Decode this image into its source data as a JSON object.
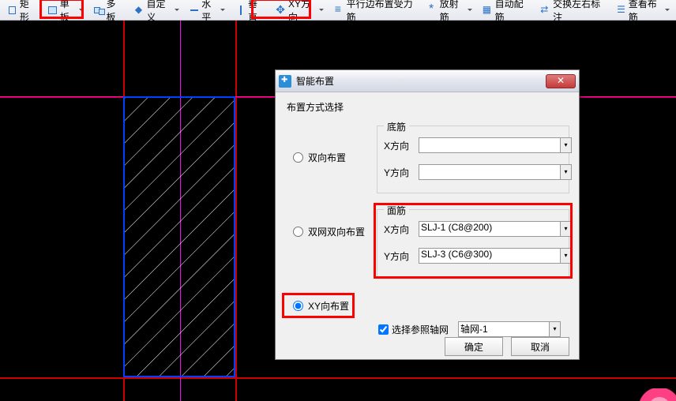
{
  "toolbar": {
    "items": [
      {
        "name": "rect-button",
        "icon": "ic-rect",
        "label": "矩形",
        "arrow": false
      },
      {
        "name": "single-board-button",
        "icon": "ic-board",
        "label": "单板",
        "arrow": true
      },
      {
        "name": "multi-board-button",
        "icon": "ic-multi",
        "label": "多板",
        "arrow": false
      },
      {
        "name": "custom-button",
        "icon": "ic-custom",
        "label": "自定义",
        "arrow": true
      },
      {
        "name": "horizontal-button",
        "icon": "ic-horiz",
        "label": "水平",
        "arrow": true
      },
      {
        "name": "vertical-button",
        "icon": "ic-vert",
        "label": "垂直",
        "arrow": false
      },
      {
        "name": "xy-direction-button",
        "icon": "ic-xy",
        "label": "XY方向",
        "arrow": true
      },
      {
        "name": "parallel-edge-button",
        "icon": "ic-parallel",
        "label": "平行边布置受力筋",
        "arrow": false
      },
      {
        "name": "radial-rebar-button",
        "icon": "ic-radial",
        "label": "放射筋",
        "arrow": true
      },
      {
        "name": "auto-rebar-button",
        "icon": "ic-auto",
        "label": "自动配筋",
        "arrow": false
      },
      {
        "name": "swap-annotate-button",
        "icon": "ic-swap",
        "label": "交换左右标注",
        "arrow": false
      },
      {
        "name": "view-rebar-button",
        "icon": "ic-view",
        "label": "查看布筋",
        "arrow": true
      }
    ]
  },
  "dialog": {
    "title": "智能布置",
    "layout_group_title": "布置方式选择",
    "radios": {
      "r1": "双向布置",
      "r2": "双网双向布置",
      "r3": "XY向布置"
    },
    "bottom_rebar": {
      "legend": "底筋",
      "x_label": "X方向",
      "y_label": "Y方向",
      "x_value": "",
      "y_value": ""
    },
    "face_rebar": {
      "legend": "面筋",
      "x_label": "X方向",
      "y_label": "Y方向",
      "x_value": "SLJ-1 (C8@200)",
      "y_value": "SLJ-3 (C6@300)"
    },
    "grid_ref": {
      "checkbox_label": "选择参照轴网",
      "value": "轴网-1"
    },
    "ok_label": "确定",
    "cancel_label": "取消"
  }
}
